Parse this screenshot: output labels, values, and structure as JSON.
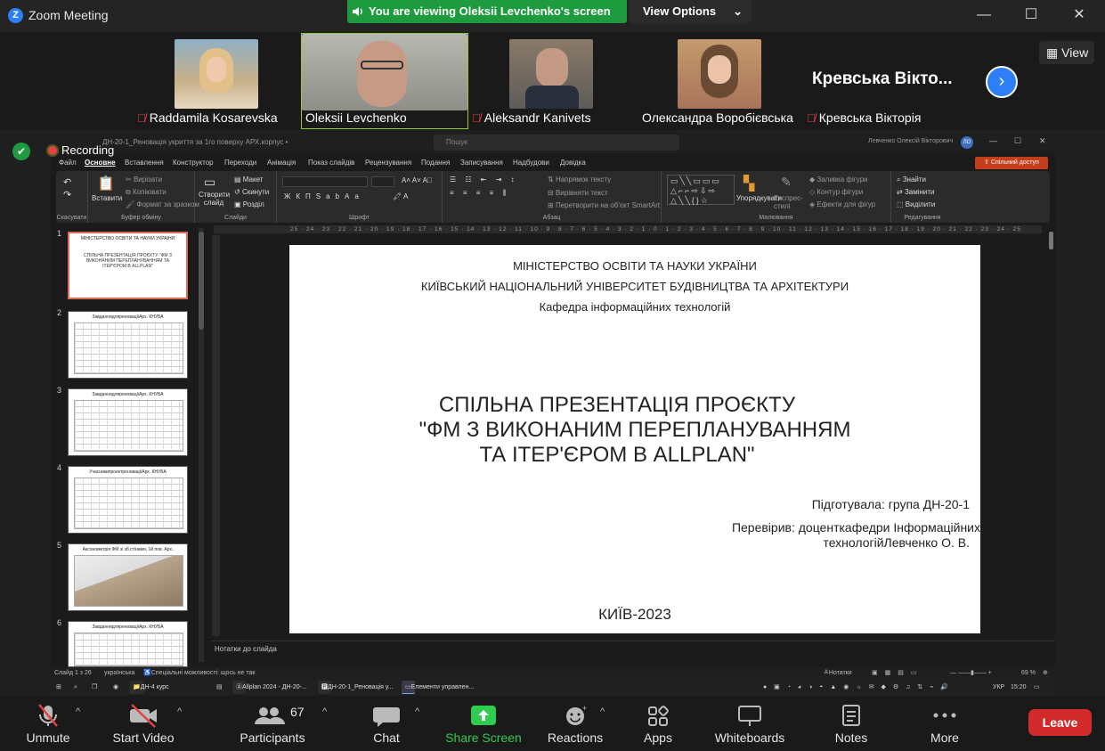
{
  "window": {
    "title": "Zoom Meeting",
    "logo": "Z"
  },
  "banner": {
    "viewing": "You are viewing Oleksii Levchenko's screen",
    "view_options": "View Options"
  },
  "gallery": {
    "participants": [
      {
        "name": "Raddamila Kosarevska",
        "muted": true
      },
      {
        "name": "Oleksii Levchenko",
        "muted": false
      },
      {
        "name": "Aleksandr Kanivets",
        "muted": true
      },
      {
        "name": "Олександра Воробієвська",
        "muted": false
      },
      {
        "name": "Кревська Вікторія",
        "muted": true
      }
    ],
    "big_name": "Кревська Вікто...",
    "view_label": "View"
  },
  "recording": {
    "label": "Recording"
  },
  "ppt": {
    "filename": "ДН-20-1_Реновація укриття за 1го поверху АРХ.корпус •",
    "search": "Пошук",
    "user": "Левченко Олексій Вікторович",
    "user_initials": "ЛО",
    "menu": [
      "Файл",
      "Основне",
      "Вставлення",
      "Конструктор",
      "Переходи",
      "Анімація",
      "Показ слайдів",
      "Рецензування",
      "Подання",
      "Записування",
      "Надбудови",
      "Довідка"
    ],
    "share_button": "Спільний доступ",
    "ribbon_groups": [
      "Скасувати",
      "Буфер обміну",
      "Слайди",
      "Шрифт",
      "Абзац",
      "Малювання",
      "Редагування"
    ],
    "ribbon": {
      "paste": "Вставити",
      "cut": "Вирізати",
      "copy": "Копіювати",
      "format_painter": "Формат за зразком",
      "new_slide": "Створити слайд",
      "layout": "Макет",
      "reset": "Скинути",
      "section": "Розділ",
      "text_direction": "Напрямок тексту",
      "align_text": "Вирівняти текст",
      "smartart": "Перетворити на об'єкт SmartArt",
      "arrange": "Упорядкувати",
      "quick_styles": "Експрес-стилі",
      "shape_fill": "Заливка фігури",
      "shape_outline": "Контур фігури",
      "shape_effects": "Ефекти для фігур",
      "find": "Знайти",
      "replace": "Замінити",
      "select": "Виділити"
    },
    "ruler_h": "25 · 24 · 23 · 22 · 21 · 20 · 19 · 18 · 17 · 16 · 15 · 14 · 13 · 12 · 11 · 10 · 9 · 8 · 7 · 6 · 5 · 4 · 3 · 2 · 1 · 0 · 1 · 2 · 3 · 4 · 5 · 6 · 7 · 8 · 9 · 10 · 11 · 12 · 13 · 14 · 15 · 16 · 17 · 18 · 19 · 20 · 21 · 22 · 23 · 24 · 25",
    "thumbnails": [
      {
        "num": "1",
        "title": "МІНІСТЕРСТВО ОСВІТИ ТА НАУКИ УКРАЇНИ",
        "caption": "СПІЛЬНА ПРЕЗЕНТАЦІЯ ПРОЄКТУ \"ФМ З ВИКОНАНИМ ПЕРЕПЛАНУВАННЯМ ТА ІТЕР'ЄРОМ В ALLPLAN\""
      },
      {
        "num": "2",
        "title": "ЗавданнядляреноваціїАрх. КНУБА",
        "caption": ""
      },
      {
        "num": "3",
        "title": "ЗавданнядляреноваціїАрх. КНУБА",
        "caption": ""
      },
      {
        "num": "4",
        "title": "УчасникипроектреноваціїАрх. КНУБА",
        "caption": ""
      },
      {
        "num": "5",
        "title": "Аксонометрія ФМ зі зб.стінами, 1й пов. Арх.",
        "caption": ""
      },
      {
        "num": "6",
        "title": "ЗавданнядляреноваціїАрх. КНУБА",
        "caption": ""
      }
    ],
    "slide": {
      "line1": "МІНІСТЕРСТВО ОСВІТИ ТА НАУКИ УКРАЇНИ",
      "line2": "КИЇВСЬКИЙ НАЦІОНАЛЬНИЙ УНІВЕРСИТЕТ БУДІВНИЦТВА ТА АРХІТЕКТУРИ",
      "line3": "Кафедра інформаційних технологій",
      "title1": "СПІЛЬНА ПРЕЗЕНТАЦІЯ ПРОЄКТУ",
      "title2": "\"ФМ З ВИКОНАНИМ ПЕРЕПЛАНУВАННЯМ",
      "title3": "ТА ІТЕР'ЄРОМ В ALLPLAN\"",
      "prepared": "Підготувала: група ДН-20-1",
      "checked1": "Перевірив: доценткафедри Інформаційних",
      "checked2": "технологійЛевченко О. В.",
      "city": "КИЇВ-2023"
    },
    "notes": "Нотатки до слайда",
    "status": {
      "slide": "Слайд 1 з 26",
      "language": "українська",
      "accessibility": "Спеціальні можливості: щось не так",
      "notes_btn": "Нотатки",
      "zoom": "69 %"
    }
  },
  "taskbar": {
    "items": [
      "ДН-4 курс",
      "Allplan 2024 - ДН-20-...",
      "ДН-20-1_Реновація у...",
      "Елементи управлен..."
    ],
    "tray": {
      "lang": "УКР",
      "time": "15:20"
    }
  },
  "toolbar": {
    "unmute": "Unmute",
    "start_video": "Start Video",
    "participants": "Participants",
    "participants_count": "67",
    "chat": "Chat",
    "share_screen": "Share Screen",
    "reactions": "Reactions",
    "apps": "Apps",
    "whiteboards": "Whiteboards",
    "notes": "Notes",
    "more": "More",
    "leave": "Leave"
  },
  "colors": {
    "share_green": "#1f9b3f",
    "accent_blue": "#2d7ff9",
    "leave_red": "#d32b2b",
    "active_tile": "#9ac93a",
    "ppt_share": "#c43e1c"
  }
}
